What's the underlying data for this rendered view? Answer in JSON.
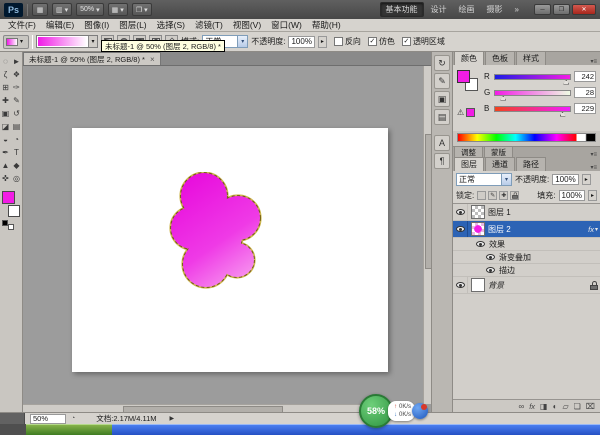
{
  "glyphs": {
    "dropdown": "▾",
    "spin": "▸",
    "more": "»",
    "minimize": "─",
    "restore": "❐",
    "close": "✕",
    "check": "✓",
    "tab_close": "×",
    "panel_menu": "▾≡",
    "arrow_right": "▶",
    "up_arrow": "↑",
    "down_arrow": "↓",
    "warning": "⚠",
    "fx": "fx"
  },
  "titlebar": {
    "logo": "Ps",
    "bridge_icon": "▦",
    "extras_icon": "▥",
    "zoom_value": "50%",
    "arrange_icon": "▦",
    "screen_icon": "❐",
    "workspaces": [
      "基本功能",
      "设计",
      "绘画",
      "摄影"
    ]
  },
  "menubar": {
    "items": [
      "文件(F)",
      "编辑(E)",
      "图像(I)",
      "图层(L)",
      "选择(S)",
      "滤镜(T)",
      "视图(V)",
      "窗口(W)",
      "帮助(H)"
    ]
  },
  "options": {
    "mode_label": "模式:",
    "mode_value": "正常",
    "opacity_label": "不透明度:",
    "opacity_value": "100%",
    "cb_reverse": "反向",
    "cb_dither": "仿色",
    "cb_transparency": "透明区域"
  },
  "tooltip_text": "未标题-1 @ 50% (图层 2, RGB/8) *",
  "doc_tab": "未标题-1 @ 50% (图层 2, RGB/8) *",
  "tools": [
    {
      "name": "rectangular-marquee",
      "glyph": "◌"
    },
    {
      "name": "move",
      "glyph": "►"
    },
    {
      "name": "lasso",
      "glyph": "ζ"
    },
    {
      "name": "quick-selection",
      "glyph": "❖"
    },
    {
      "name": "crop",
      "glyph": "⊞"
    },
    {
      "name": "eyedropper",
      "glyph": "✑"
    },
    {
      "name": "healing-brush",
      "glyph": "✚"
    },
    {
      "name": "brush",
      "glyph": "✎"
    },
    {
      "name": "clone-stamp",
      "glyph": "▣"
    },
    {
      "name": "history-brush",
      "glyph": "↺"
    },
    {
      "name": "eraser",
      "glyph": "◪"
    },
    {
      "name": "gradient",
      "glyph": "▤"
    },
    {
      "name": "blur",
      "glyph": "◒"
    },
    {
      "name": "dodge",
      "glyph": "◔"
    },
    {
      "name": "pen",
      "glyph": "✒"
    },
    {
      "name": "type",
      "glyph": "T"
    },
    {
      "name": "path-selection",
      "glyph": "▲"
    },
    {
      "name": "shape",
      "glyph": "◆"
    },
    {
      "name": "hand",
      "glyph": "✜"
    },
    {
      "name": "zoom",
      "glyph": "◎"
    }
  ],
  "dock_icons": [
    {
      "name": "history",
      "glyph": "↻"
    },
    {
      "name": "brush-panel",
      "glyph": "✎"
    },
    {
      "name": "clone-source",
      "glyph": "▣"
    },
    {
      "name": "layer-comps",
      "glyph": "▤"
    },
    {
      "name": "character",
      "glyph": "A"
    },
    {
      "name": "paragraph",
      "glyph": "¶"
    }
  ],
  "color_panel": {
    "tabs": [
      "颜色",
      "色板",
      "样式"
    ],
    "r_label": "R",
    "r_value": "242",
    "g_label": "G",
    "g_value": "28",
    "b_label": "B",
    "b_value": "229"
  },
  "adjust_tabs": [
    "调整",
    "蒙版"
  ],
  "layers_panel": {
    "tabs": [
      "图层",
      "通道",
      "路径"
    ],
    "blend_mode": "正常",
    "opacity_label": "不透明度:",
    "opacity_value": "100%",
    "lock_label": "锁定:",
    "fill_label": "填充:",
    "fill_value": "100%",
    "layer1": "图层 1",
    "layer2": "图层 2",
    "effects": "效果",
    "gradient_overlay": "渐变叠加",
    "stroke": "描边",
    "background": "背景"
  },
  "statusbar": {
    "zoom": "50%",
    "doc_info": "文档:2.17M/4.11M"
  },
  "overlay": {
    "percent": "58%",
    "up_speed": "0K/s",
    "down_speed": "0K/s"
  },
  "colors": {
    "foreground": "#F21CE5",
    "selection_blue": "#2C63B5",
    "stroke_effect": "#6D5A10"
  }
}
